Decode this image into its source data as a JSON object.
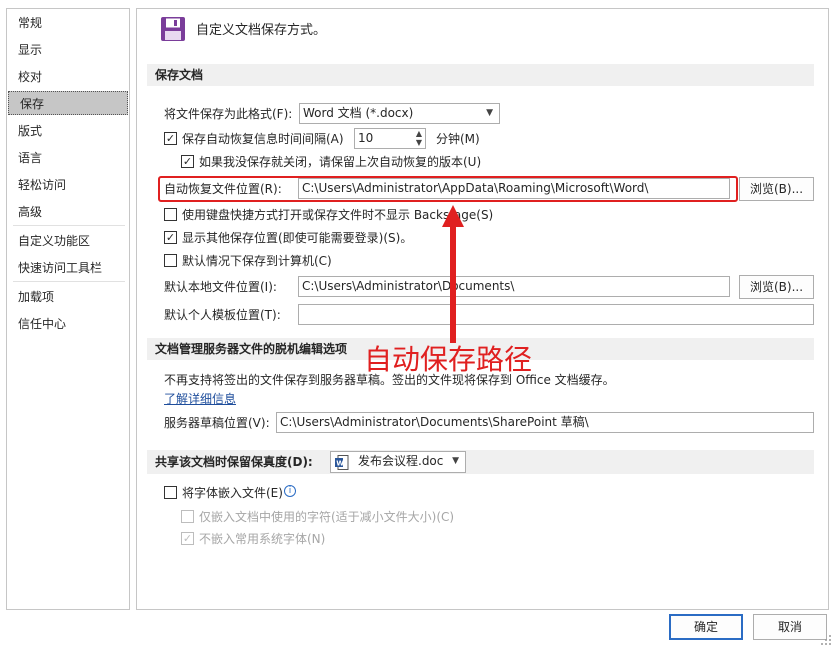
{
  "sidebar": {
    "items": [
      {
        "label": "常规"
      },
      {
        "label": "显示"
      },
      {
        "label": "校对"
      },
      {
        "label": "保存"
      },
      {
        "label": "版式"
      },
      {
        "label": "语言"
      },
      {
        "label": "轻松访问"
      },
      {
        "label": "高级"
      },
      {
        "label": "自定义功能区"
      },
      {
        "label": "快速访问工具栏"
      },
      {
        "label": "加载项"
      },
      {
        "label": "信任中心"
      }
    ]
  },
  "header": {
    "title": "自定义文档保存方式。"
  },
  "save_section": {
    "title": "保存文档",
    "format_label": "将文件保存为此格式(F):",
    "format_value": "Word 文档 (*.docx)",
    "autorecover_label": "保存自动恢复信息时间间隔(A)",
    "autorecover_checked": true,
    "autorecover_minutes": "10",
    "minutes_unit": "分钟(M)",
    "keep_last_label": "如果我没保存就关闭，请保留上次自动恢复的版本(U)",
    "keep_last_checked": true,
    "autorecover_location_label": "自动恢复文件位置(R):",
    "autorecover_location_value": "C:\\Users\\Administrator\\AppData\\Roaming\\Microsoft\\Word\\",
    "browse_label": "浏览(B)...",
    "no_backstage_label": "使用键盘快捷方式打开或保存文件时不显示 Backstage(S)",
    "no_backstage_checked": false,
    "show_other_label": "显示其他保存位置(即使可能需要登录)(S)。",
    "show_other_checked": true,
    "save_local_label": "默认情况下保存到计算机(C)",
    "save_local_checked": false,
    "local_location_label": "默认本地文件位置(I):",
    "local_location_value": "C:\\Users\\Administrator\\Documents\\",
    "browse2_label": "浏览(B)...",
    "template_location_label": "默认个人模板位置(T):",
    "template_location_value": ""
  },
  "annotation": {
    "text": "自动保存路径",
    "color": "#e02020"
  },
  "offline_section": {
    "title": "文档管理服务器文件的脱机编辑选项",
    "info_text": "不再支持将签出的文件保存到服务器草稿。签出的文件现将保存到 Office 文档缓存。",
    "learn_more": "了解详细信息",
    "drafts_label": "服务器草稿位置(V):",
    "drafts_value": "C:\\Users\\Administrator\\Documents\\SharePoint 草稿\\"
  },
  "fidelity_section": {
    "title": "共享该文档时保留保真度(D):",
    "document_value": "发布会议程.doc",
    "embed_fonts_label": "将字体嵌入文件(E)",
    "embed_fonts_checked": false,
    "embed_used_label": "仅嵌入文档中使用的字符(适于减小文件大小)(C)",
    "embed_used_checked": false,
    "no_common_label": "不嵌入常用系统字体(N)",
    "no_common_checked": true
  },
  "footer": {
    "ok_label": "确定",
    "cancel_label": "取消"
  },
  "colors": {
    "accent": "#7a3d9a",
    "section_bg": "#f0f0f0",
    "selected_bg": "#c6c6c6"
  }
}
